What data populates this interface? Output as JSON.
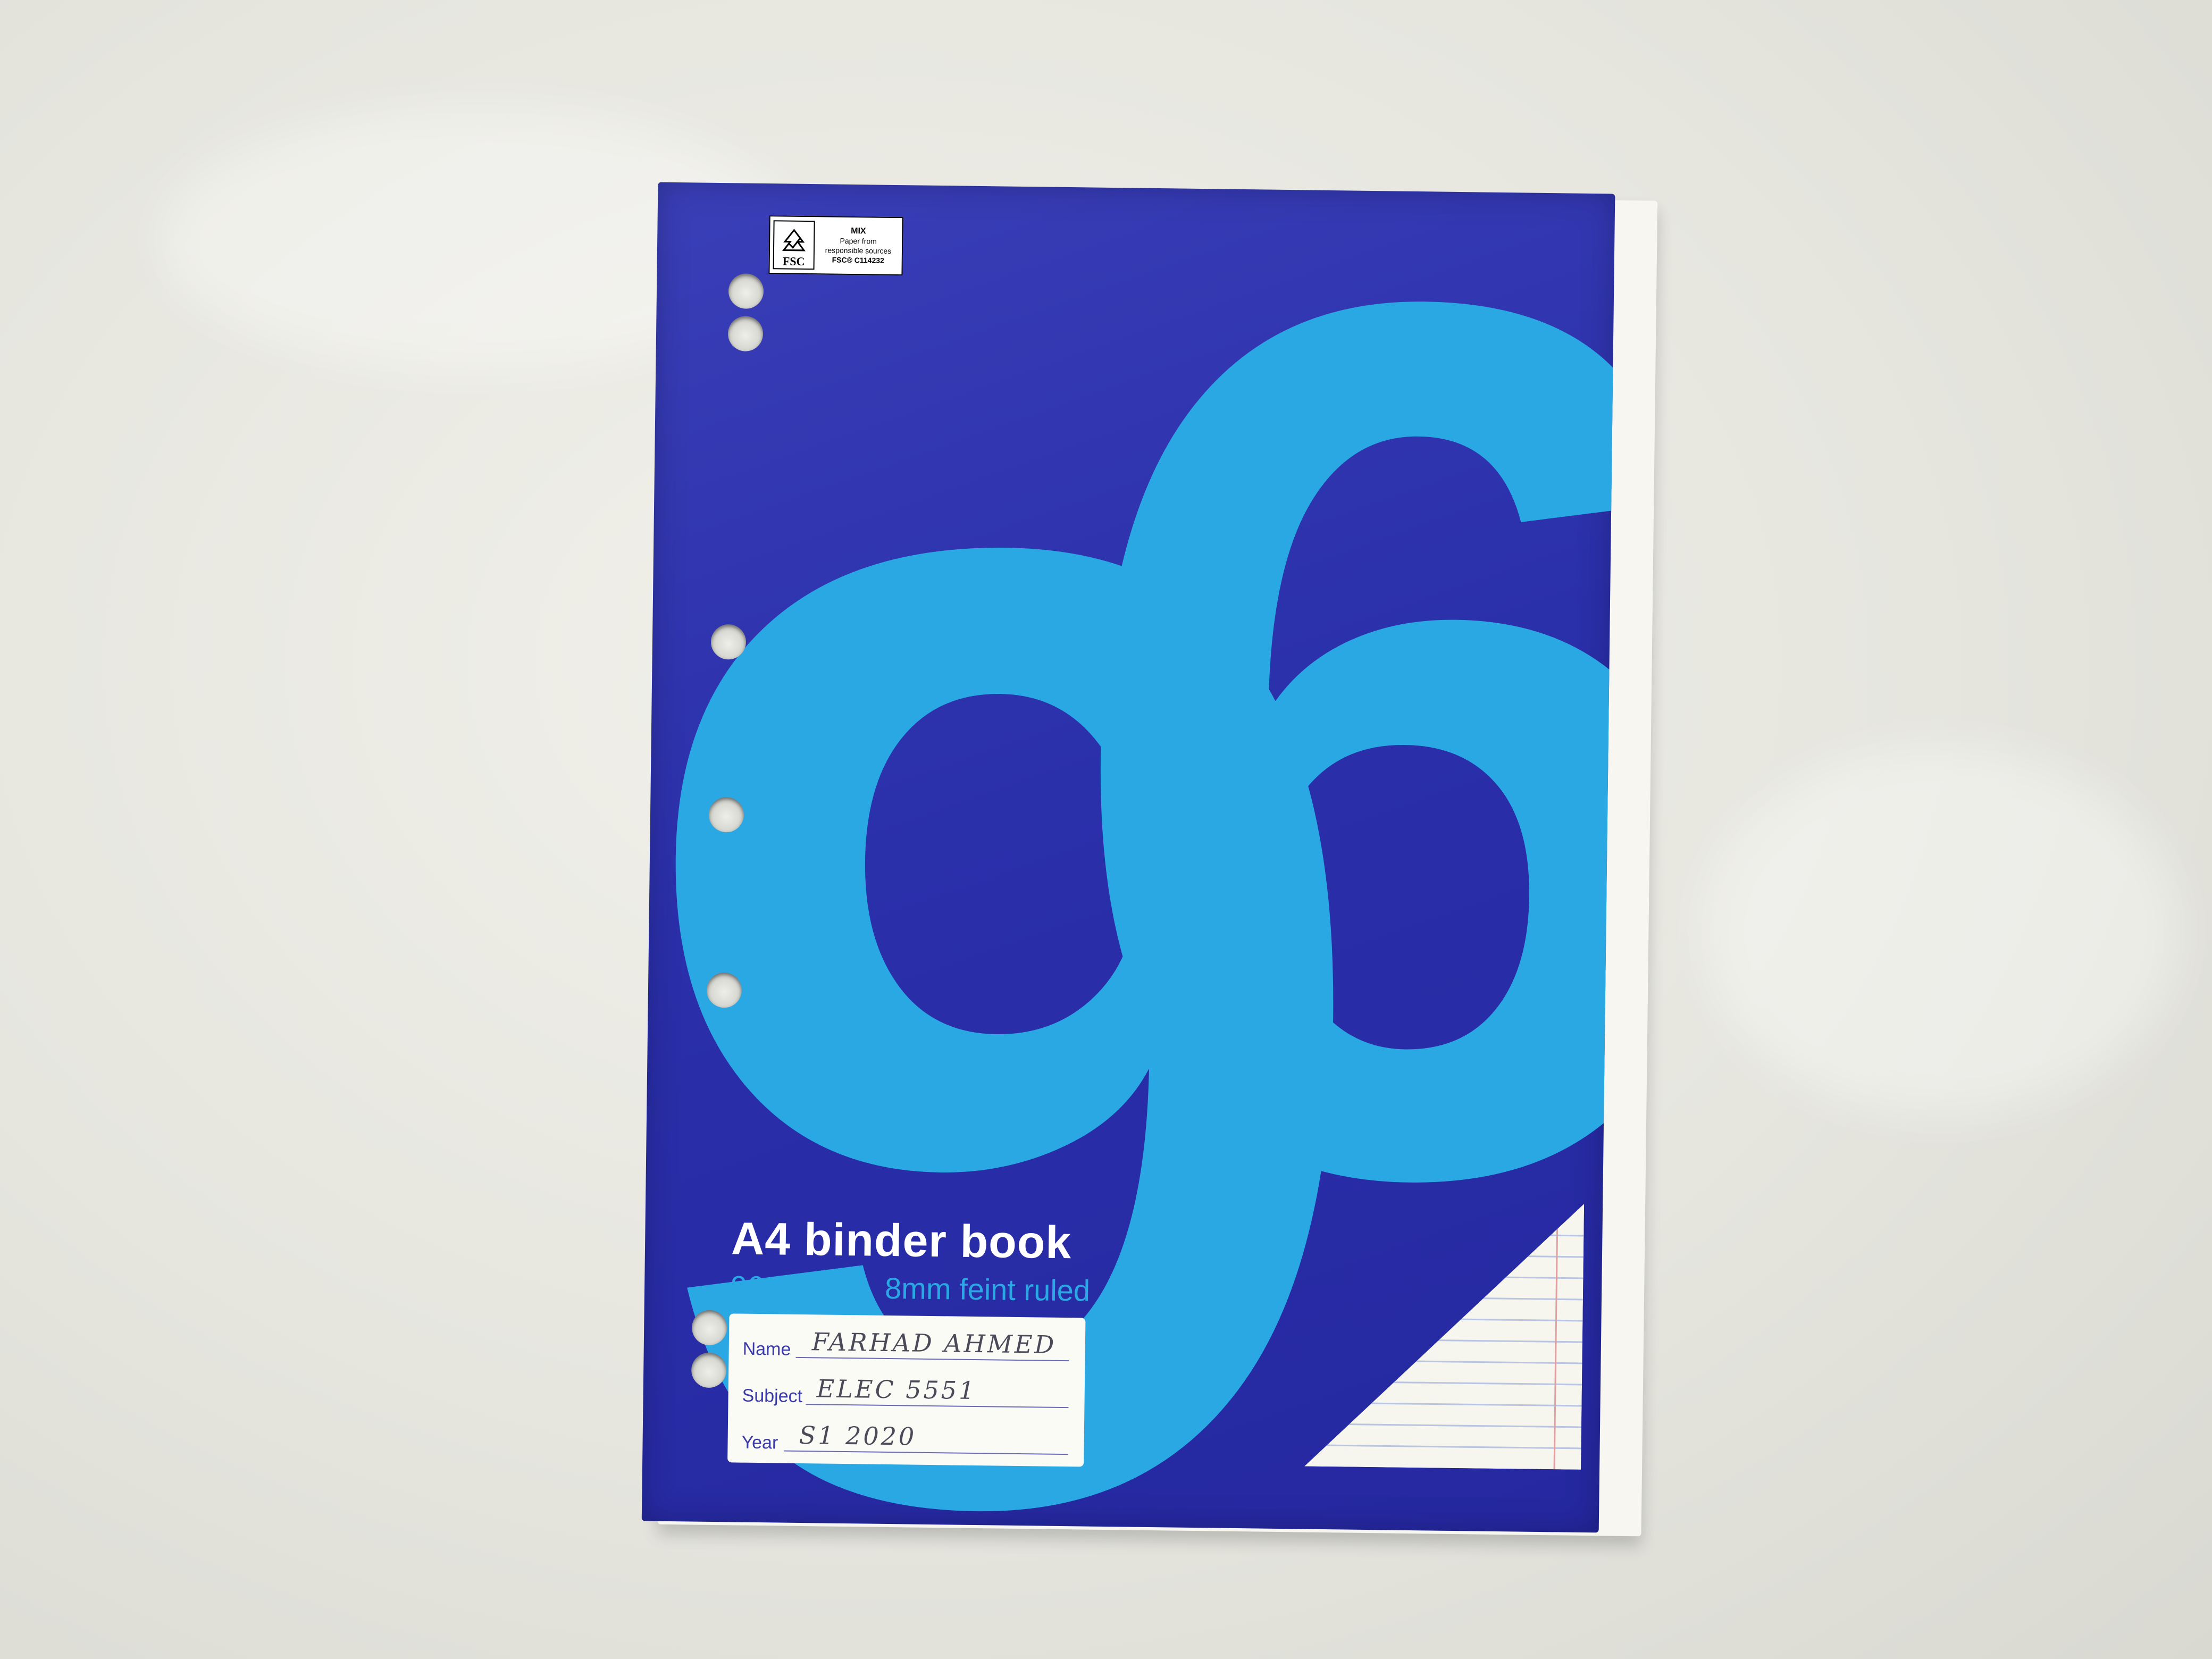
{
  "scene": "notebook-on-fabric",
  "colors": {
    "background_fabric": "#e6e6df",
    "cover_blue": "#2a2faa",
    "accent_cyan": "#2aa8e4",
    "label_white": "#fbfbf6"
  },
  "cover": {
    "big_number": {
      "digit_1": "9",
      "digit_2": "6"
    },
    "title": "A4 binder book",
    "subtitle_pages": "96 page",
    "subtitle_ruling": "8mm feint ruled",
    "fsc_label": {
      "logo_text": "FSC",
      "mix": "MIX",
      "line_1": "Paper from",
      "line_2": "responsible sources",
      "code": "FSC® C114232"
    },
    "name_label": {
      "name_label": "Name",
      "name_value": "FARHAD AHMED",
      "subject_label": "Subject",
      "subject_value": "ELEC 5551",
      "year_label": "Year",
      "year_value": "S1 2020"
    }
  }
}
